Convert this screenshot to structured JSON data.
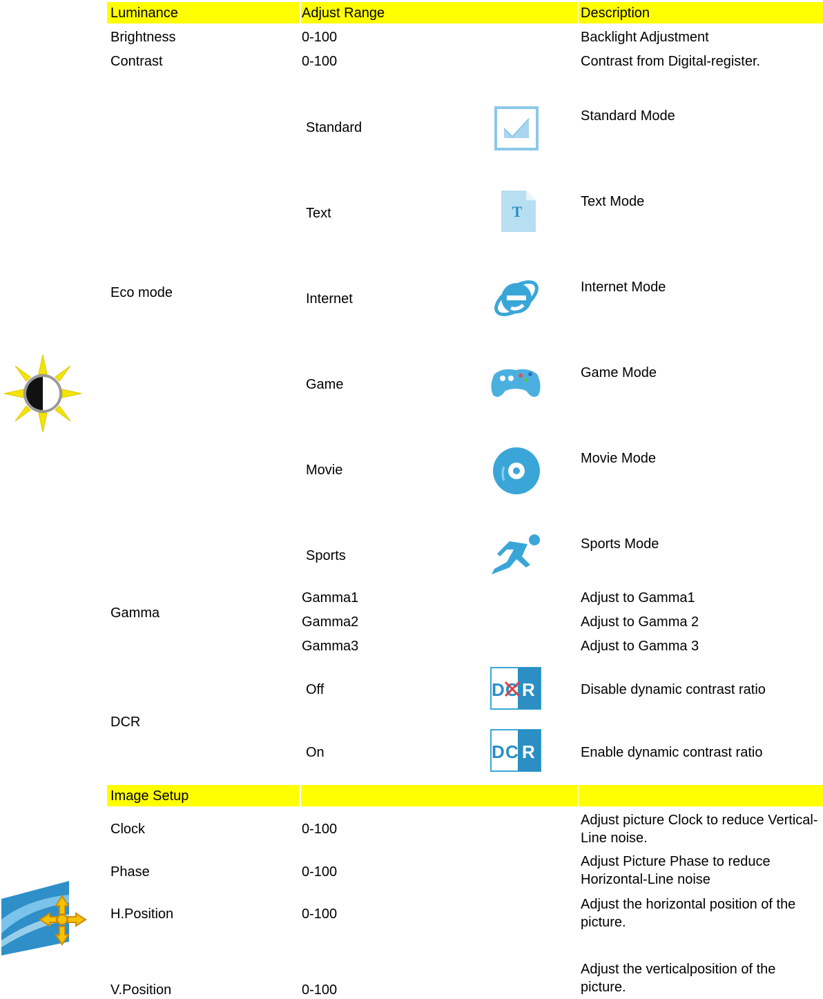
{
  "luminance": {
    "header": {
      "col1": "Luminance",
      "col2": "Adjust Range",
      "col3": "Description"
    },
    "rows": [
      {
        "name": "Brightness",
        "range": "0-100",
        "desc": "Backlight Adjustment"
      },
      {
        "name": "Contrast",
        "range": "0-100",
        "desc": "Contrast from Digital-register."
      }
    ],
    "eco_mode": {
      "label": "Eco mode",
      "options": [
        {
          "name": "Standard",
          "icon": "standard-checkbox-icon",
          "desc": "Standard Mode"
        },
        {
          "name": "Text",
          "icon": "text-document-icon",
          "desc": "Text Mode"
        },
        {
          "name": "Internet",
          "icon": "internet-explorer-icon",
          "desc": "Internet Mode"
        },
        {
          "name": "Game",
          "icon": "gamepad-icon",
          "desc": "Game Mode"
        },
        {
          "name": "Movie",
          "icon": "disc-icon",
          "desc": "Movie Mode"
        },
        {
          "name": "Sports",
          "icon": "runner-icon",
          "desc": "Sports Mode"
        }
      ]
    },
    "gamma": {
      "label": "Gamma",
      "options": [
        {
          "name": "Gamma1",
          "desc": "Adjust to Gamma1"
        },
        {
          "name": "Gamma2",
          "desc": "Adjust to Gamma 2"
        },
        {
          "name": "Gamma3",
          "desc": "Adjust to Gamma 3"
        }
      ]
    },
    "dcr": {
      "label": "DCR",
      "dcr_logo_text": "DCR",
      "options": [
        {
          "name": "Off",
          "icon": "dcr-off-icon",
          "desc": "Disable dynamic contrast ratio"
        },
        {
          "name": "On",
          "icon": "dcr-on-icon",
          "desc": "Enable dynamic contrast ratio"
        }
      ]
    },
    "section_icon": "brightness-sun-icon"
  },
  "image_setup": {
    "header": {
      "col1": "Image Setup",
      "col2": "",
      "col3": ""
    },
    "section_icon": "image-position-icon",
    "rows": [
      {
        "name": "Clock",
        "range": "0-100",
        "desc": "Adjust picture Clock to reduce Vertical-Line noise."
      },
      {
        "name": "Phase",
        "range": "0-100",
        "desc": "Adjust Picture Phase to reduce Horizontal-Line noise"
      },
      {
        "name": "H.Position",
        "range": "0-100",
        "desc": "Adjust the horizontal position of the picture."
      },
      {
        "name": "V.Position",
        "range": "0-100",
        "desc": "Adjust the verticalposition of the picture."
      }
    ]
  },
  "colors": {
    "highlight": "#ffff00",
    "icon_blue": "#3aa6d8",
    "icon_light_blue": "#a9d6ee",
    "sun_yellow": "#f5e400"
  }
}
